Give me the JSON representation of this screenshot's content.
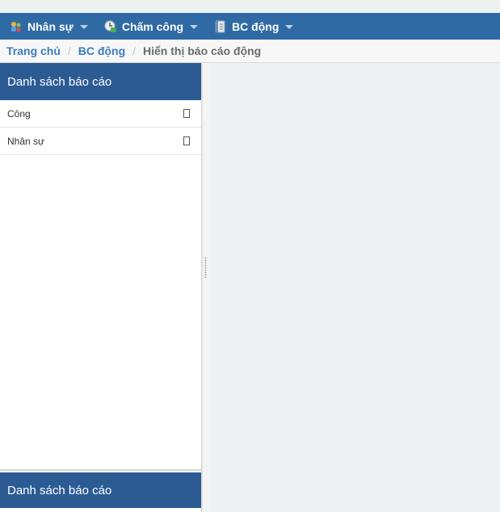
{
  "menubar": {
    "items": [
      {
        "label": "Nhân sự",
        "icon": "people-icon"
      },
      {
        "label": "Chấm công",
        "icon": "timecard-icon"
      },
      {
        "label": "BC động",
        "icon": "notebook-icon"
      }
    ]
  },
  "breadcrumb": {
    "home": "Trang chủ",
    "section": "BC động",
    "current": "Hiển thị báo cáo động",
    "separator": "/"
  },
  "report_panel": {
    "title": "Danh sách báo cáo",
    "items": [
      {
        "label": "Công"
      },
      {
        "label": "Nhân sự"
      }
    ]
  },
  "bottom_panel": {
    "title": "Danh sách báo cáo"
  },
  "colors": {
    "menubar": "#2f6aa5",
    "panel_header": "#2c5b94",
    "link": "#3b7dbf"
  }
}
